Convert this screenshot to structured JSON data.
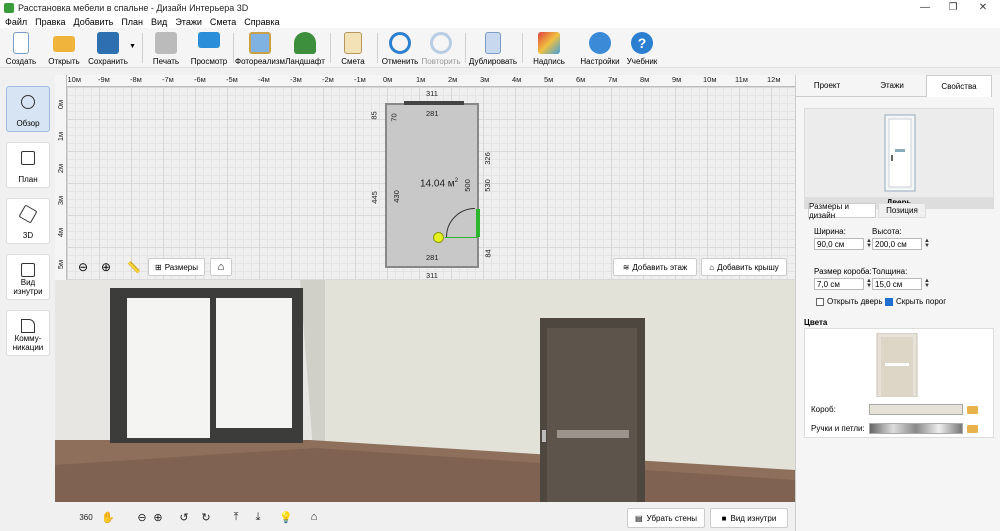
{
  "window": {
    "title": "Расстановка мебели в спальне - Дизайн Интерьера 3D",
    "minimize": "—",
    "restore": "❐",
    "close": "✕"
  },
  "menu": [
    "Файл",
    "Правка",
    "Добавить",
    "План",
    "Вид",
    "Этажи",
    "Смета",
    "Справка"
  ],
  "toolbar": {
    "create": "Создать",
    "open": "Открыть",
    "save": "Сохранить",
    "print": "Печать",
    "preview": "Просмотр",
    "photo": "Фотореализм",
    "landscape": "Ландшафт",
    "estimate": "Смета",
    "undo": "Отменить",
    "redo": "Повторить",
    "duplicate": "Дублировать",
    "caption": "Надпись",
    "settings": "Настройки",
    "tutorial": "Учебник"
  },
  "left_panel": {
    "overview": "Обзор",
    "plan": "План",
    "three_d": "3D",
    "inside_view": "Вид изнутри",
    "communications": "Комму-никации"
  },
  "ruler": {
    "top": [
      "-10м",
      "-9м",
      "-8м",
      "-7м",
      "-6м",
      "-5м",
      "-4м",
      "-3м",
      "-2м",
      "-1м",
      "0м",
      "1м",
      "2м",
      "3м",
      "4м",
      "5м",
      "6м",
      "7м",
      "8м",
      "9м",
      "10м",
      "11м",
      "12м"
    ],
    "left": [
      "0м",
      "1м",
      "2м",
      "3м",
      "4м",
      "5м"
    ]
  },
  "plan": {
    "area": "14.04 м",
    "area_sup": "2",
    "dim_top": "311",
    "dim_top_inner": "281",
    "dim_bottom": "311",
    "dim_bottom_inner": "281",
    "dim_left_outer": "445",
    "dim_left_top": "85",
    "dim_left_inner": "430",
    "dim_left_small": "70",
    "dim_right_326": "326",
    "dim_right_530": "530",
    "dim_right_500": "500",
    "dim_right_84": "84",
    "sizes_button": "Размеры",
    "add_floor": "Добавить этаж",
    "add_roof": "Добавить крышу"
  },
  "bottom_bar": {
    "remove_walls": "Убрать стены",
    "inside_view": "Вид изнутри",
    "rotate360": "360"
  },
  "right_panel": {
    "tabs": [
      "Проект",
      "Этажи",
      "Свойства"
    ],
    "object_name": "Дверь",
    "sub_tabs": [
      "Размеры и дизайн",
      "Позиция"
    ],
    "width_label": "Ширина:",
    "width_value": "90,0 см",
    "height_label": "Высота:",
    "height_value": "200,0 см",
    "frame_label": "Размер короба:",
    "frame_value": "7,0 см",
    "thickness_label": "Толщина:",
    "thickness_value": "15,0 см",
    "open_door": "Открыть дверь",
    "hide_threshold": "Скрыть порог",
    "colors_header": "Цвета",
    "frame_color": "Короб:",
    "handles": "Ручки и петли:"
  },
  "colors": {
    "accent": "#1f6fd0",
    "wall": "#e6e4da",
    "floor": "#8a6a55",
    "door": "#5d554c",
    "window_frame": "#3c3c3a"
  }
}
